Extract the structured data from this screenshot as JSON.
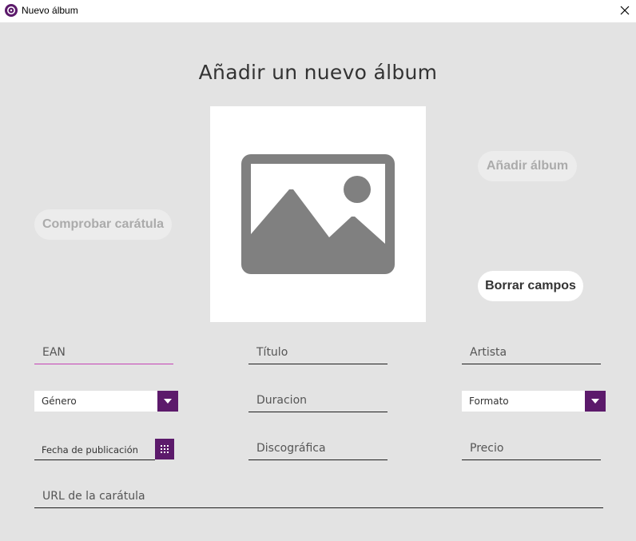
{
  "window": {
    "title": "Nuevo álbum",
    "icon": "app-icon",
    "close_icon": "close-icon"
  },
  "page": {
    "heading": "Añadir un nuevo álbum",
    "cover_icon": "image-placeholder-icon"
  },
  "buttons": {
    "check_cover": "Comprobar carátula",
    "add_album": "Añadir álbum",
    "clear_fields": "Borrar campos"
  },
  "fields": {
    "ean": "EAN",
    "title": "Título",
    "artist": "Artista",
    "genre": "Género",
    "duration": "Duracion",
    "format": "Formato",
    "release_date": "Fecha de publicación",
    "label": "Discográfica",
    "price": "Precio",
    "cover_url": "URL de la carátula"
  },
  "colors": {
    "accent": "#5c1a6b",
    "focus_underline": "#c542b5",
    "background": "#e3e3e3",
    "placeholder_image": "#808080"
  }
}
